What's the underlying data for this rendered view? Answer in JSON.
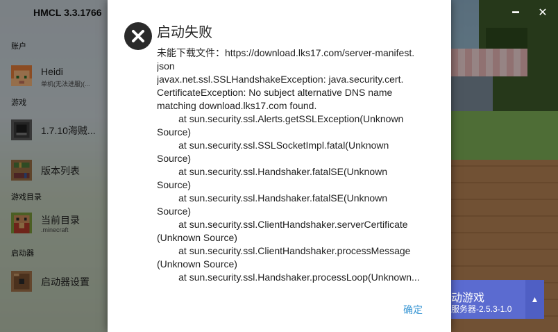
{
  "app": {
    "title": "HMCL 3.3.1766"
  },
  "sidebar": {
    "account_section": "账户",
    "account": {
      "name": "Heidi",
      "subtitle": "单机(无法进服)(..."
    },
    "game_section": "游戏",
    "game_items": [
      {
        "label": "1.7.10海贼..."
      },
      {
        "label": "版本列表"
      }
    ],
    "dir_section": "游戏目录",
    "dir_item": {
      "label": "当前目录",
      "subtitle": ".minecraft"
    },
    "launcher_section": "启动器",
    "launcher_item": {
      "label": "启动器设置"
    }
  },
  "window": {
    "minimize": "━",
    "close": "✕"
  },
  "launch": {
    "label": "动游戏",
    "subtitle": "服务器-2.5.3-1.0",
    "more": "▲"
  },
  "dialog": {
    "icon": "error-icon",
    "title": "启动失败",
    "message": "未能下载文件：https://download.lks17.com/server-manifest.\njson\njavax.net.ssl.SSLHandshakeException: java.security.cert.\nCertificateException: No subject alternative DNS name\nmatching download.lks17.com found.\n        at sun.security.ssl.Alerts.getSSLException(Unknown\nSource)\n        at sun.security.ssl.SSLSocketImpl.fatal(Unknown\nSource)\n        at sun.security.ssl.Handshaker.fatalSE(Unknown\nSource)\n        at sun.security.ssl.Handshaker.fatalSE(Unknown\nSource)\n        at sun.security.ssl.ClientHandshaker.serverCertificate\n(Unknown Source)\n        at sun.security.ssl.ClientHandshaker.processMessage\n(Unknown Source)\n        at sun.security.ssl.Handshaker.processLoop(Unknown...",
    "ok": "确定"
  }
}
